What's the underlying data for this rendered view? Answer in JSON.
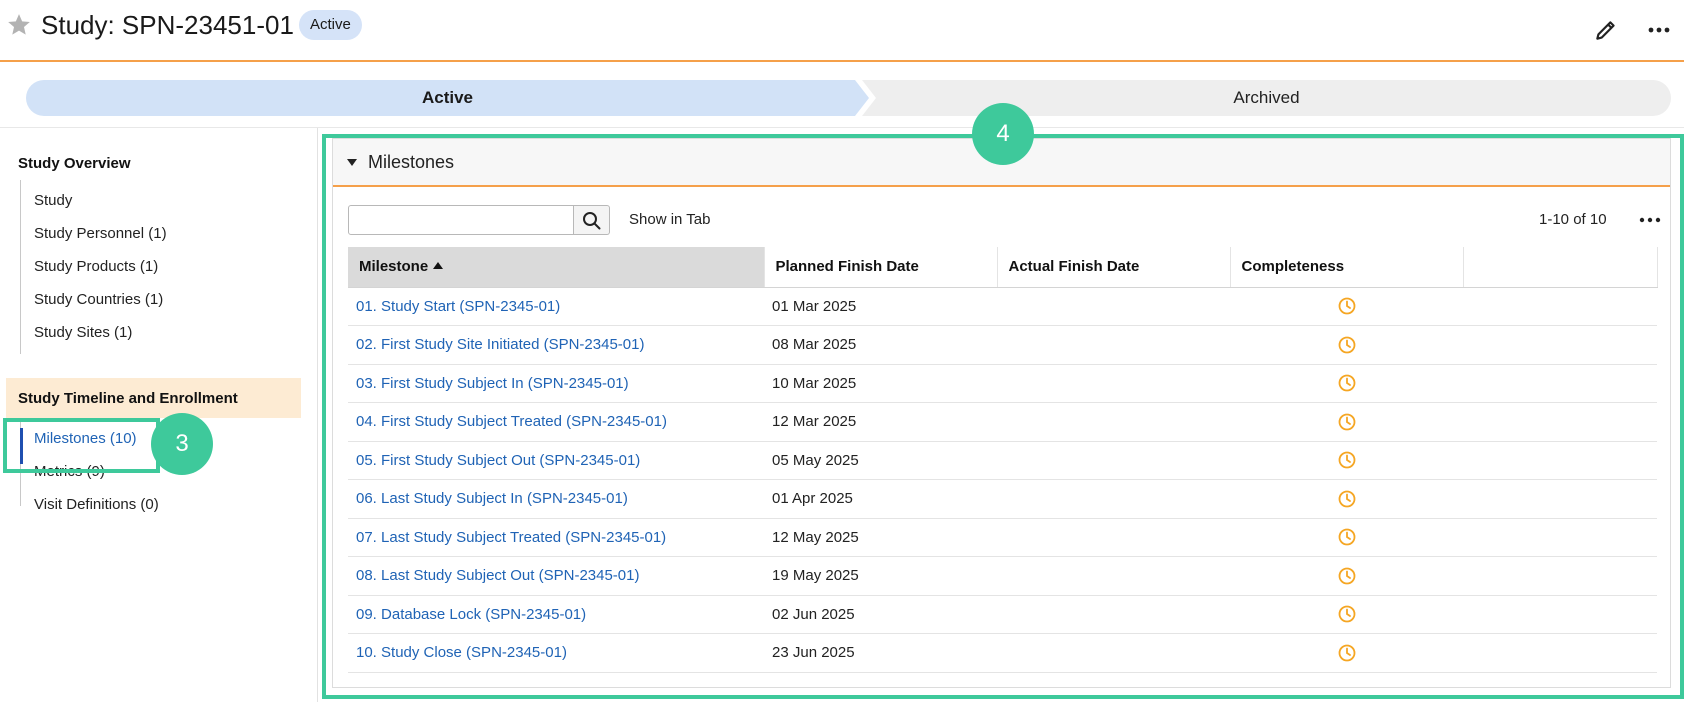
{
  "header": {
    "title": "Study: SPN-23451-01",
    "status_badge": "Active"
  },
  "lifecycle": {
    "stages": [
      {
        "label": "Active",
        "current": true
      },
      {
        "label": "Archived",
        "current": false
      }
    ]
  },
  "sidebar": {
    "section1": {
      "title": "Study Overview",
      "items": [
        "Study",
        "Study Personnel (1)",
        "Study Products (1)",
        "Study Countries (1)",
        "Study Sites (1)"
      ]
    },
    "section2": {
      "title": "Study Timeline and Enrollment",
      "items": [
        "Milestones (10)",
        "Metrics (9)",
        "Visit Definitions (0)"
      ],
      "selected": "Milestones (10)"
    }
  },
  "milestones": {
    "title": "Milestones",
    "search": {
      "value": "",
      "placeholder": ""
    },
    "show_in_tab": "Show in Tab",
    "paging": "1-10 of 10",
    "columns": [
      "Milestone",
      "Planned Finish Date",
      "Actual Finish Date",
      "Completeness"
    ],
    "rows": [
      {
        "milestone": "01. Study Start (SPN-2345-01)",
        "planned": "01 Mar 2025",
        "actual": "",
        "completeness": "clock-icon"
      },
      {
        "milestone": "02. First Study Site Initiated (SPN-2345-01)",
        "planned": "08 Mar 2025",
        "actual": "",
        "completeness": "clock-icon"
      },
      {
        "milestone": "03. First Study Subject In (SPN-2345-01)",
        "planned": "10 Mar 2025",
        "actual": "",
        "completeness": "clock-icon"
      },
      {
        "milestone": "04. First Study Subject Treated (SPN-2345-01)",
        "planned": "12 Mar 2025",
        "actual": "",
        "completeness": "clock-icon"
      },
      {
        "milestone": "05. First Study Subject Out (SPN-2345-01)",
        "planned": "05 May 2025",
        "actual": "",
        "completeness": "clock-icon"
      },
      {
        "milestone": "06. Last Study Subject In (SPN-2345-01)",
        "planned": "01 Apr 2025",
        "actual": "",
        "completeness": "clock-icon"
      },
      {
        "milestone": "07. Last Study Subject Treated (SPN-2345-01)",
        "planned": "12 May 2025",
        "actual": "",
        "completeness": "clock-icon"
      },
      {
        "milestone": "08. Last Study Subject Out (SPN-2345-01)",
        "planned": "19 May 2025",
        "actual": "",
        "completeness": "clock-icon"
      },
      {
        "milestone": "09. Database Lock (SPN-2345-01)",
        "planned": "02 Jun 2025",
        "actual": "",
        "completeness": "clock-icon"
      },
      {
        "milestone": "10. Study Close (SPN-2345-01)",
        "planned": "23 Jun 2025",
        "actual": "",
        "completeness": "clock-icon"
      }
    ]
  },
  "annotations": {
    "callout3": "3",
    "callout4": "4"
  },
  "colors": {
    "accent_orange": "#f5a04a",
    "link_blue": "#1f63b5",
    "callout_green": "#3ec99b",
    "clock_orange": "#f5a623"
  }
}
